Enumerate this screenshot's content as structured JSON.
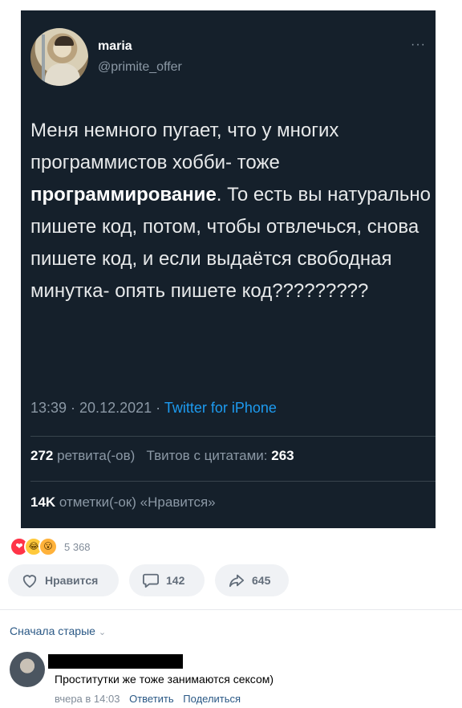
{
  "tweet": {
    "name": "maria",
    "handle": "@primite_offer",
    "more": "···",
    "text_before": "Меня немного пугает, что у многих программистов хобби- тоже ",
    "text_bold": "программирование",
    "text_after": ". То есть вы натурально пишете код, потом, чтобы отвлечься, снова пишете код, и если выдаётся свободная минутка- опять пишете код?????????",
    "time": "13:39 · 20.12.2021 · ",
    "source": "Twitter for iPhone",
    "retweets_count": "272",
    "retweets_label": "ретвита(-ов)",
    "quotes_label": "Твитов с цитатами:",
    "quotes_count": "263",
    "likes_count": "14K",
    "likes_label": "отметки(-ок) «Нравится»"
  },
  "post": {
    "reactions_count": "5 368",
    "like_label": "Нравится",
    "comments_count": "142",
    "shares_count": "645"
  },
  "comments": {
    "sort_label": "Сначала старые",
    "sort_chevron": "⌄",
    "items": [
      {
        "text": "Проститутки же тоже занимаются сексом)",
        "date": "вчера в 14:03",
        "reply_label": "Ответить",
        "share_label": "Поделиться"
      }
    ]
  }
}
